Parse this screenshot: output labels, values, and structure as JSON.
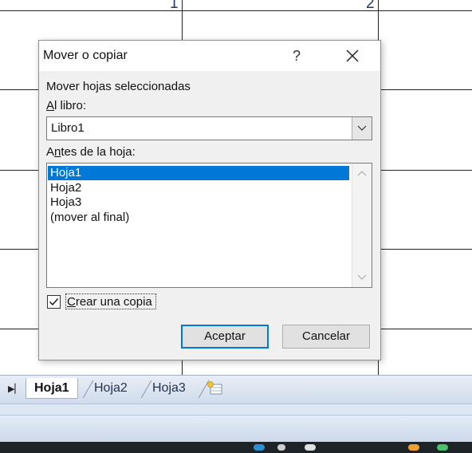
{
  "sheet": {
    "column_numbers": [
      "1",
      "2"
    ]
  },
  "dialog": {
    "title": "Mover o copiar",
    "help_label": "?",
    "close_icon": "close-icon",
    "move_label": "Mover hojas seleccionadas",
    "book_label_mnemonic": "A",
    "book_label_rest": "l libro:",
    "book_value": "Libro1",
    "before_label_pre": "A",
    "before_label_mnemonic": "n",
    "before_label_rest": "tes de la hoja:",
    "sheets": [
      "Hoja1",
      "Hoja2",
      "Hoja3",
      "(mover al final)"
    ],
    "selected_sheet": "Hoja1",
    "copy_checked": true,
    "copy_label_mnemonic": "C",
    "copy_label_rest": "rear una copia",
    "ok_label": "Aceptar",
    "cancel_label": "Cancelar"
  },
  "tabs": {
    "items": [
      "Hoja1",
      "Hoja2",
      "Hoja3"
    ],
    "active": "Hoja1"
  },
  "colors": {
    "selection": "#0078d7",
    "default_button_border": "#0078d7",
    "tabbar": "#cfdaea"
  }
}
